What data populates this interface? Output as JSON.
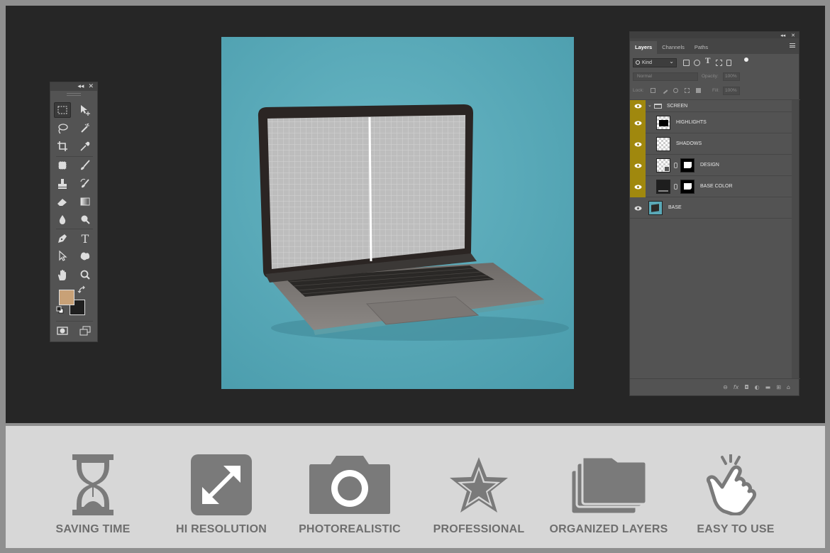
{
  "tools_panel": {
    "collapse_glyph": "◂◂",
    "close_glyph": "✕",
    "foreground_color": "#c8a177",
    "background_color": "#1f1f1f",
    "icons": [
      "marquee-icon",
      "move-icon",
      "lasso-icon",
      "magic-wand-icon",
      "crop-icon",
      "eyedropper-icon",
      "healing-icon",
      "brush-icon",
      "stamp-icon",
      "history-brush-icon",
      "eraser-icon",
      "gradient-icon",
      "blur-icon",
      "dodge-icon",
      "pen-icon",
      "type-icon",
      "path-select-icon",
      "shape-icon",
      "hand-icon",
      "zoom-icon",
      "swap-colors-icon",
      "default-colors-icon",
      "quick-mask-icon",
      "screen-mode-icon"
    ],
    "type_glyph": "T"
  },
  "layers_panel": {
    "collapse_glyph": "◂◂",
    "close_glyph": "✕",
    "tabs": [
      {
        "label": "Layers",
        "active": true
      },
      {
        "label": "Channels",
        "active": false
      },
      {
        "label": "Paths",
        "active": false
      }
    ],
    "filter": {
      "kind_label": "Kind",
      "type_glyph": "T"
    },
    "blend_mode": "Normal",
    "opacity_label": "Opacity:",
    "opacity_value": "100%",
    "lock_label": "Lock:",
    "fill_label": "Fill:",
    "fill_value": "100%",
    "group": {
      "name": "SCREEN"
    },
    "layers": [
      {
        "name": "HIGHLIGHTS"
      },
      {
        "name": "SHADOWS"
      },
      {
        "name": "DESIGN"
      },
      {
        "name": "BASE COLOR"
      },
      {
        "name": "BASE"
      }
    ],
    "bottom_glyphs": {
      "link": "⊖",
      "fx": "fx",
      "mask": "◘",
      "adjust": "◐",
      "folder": "▬",
      "new": "⊞",
      "trash": "⌂"
    }
  },
  "features": [
    {
      "label": "SAVING TIME",
      "icon": "hourglass-icon"
    },
    {
      "label": "HI RESOLUTION",
      "icon": "expand-icon"
    },
    {
      "label": "PHOTOREALISTIC",
      "icon": "camera-icon"
    },
    {
      "label": "PROFESSIONAL",
      "icon": "star-icon"
    },
    {
      "label": "ORGANIZED LAYERS",
      "icon": "folders-icon"
    },
    {
      "label": "EASY TO USE",
      "icon": "hand-tap-icon"
    }
  ],
  "colors": {
    "workspace": "#262626",
    "canvas": "#5aa9b8",
    "panel": "#535353",
    "visibility_highlight": "#a0880e",
    "feature_icon": "#7a7a7a"
  }
}
